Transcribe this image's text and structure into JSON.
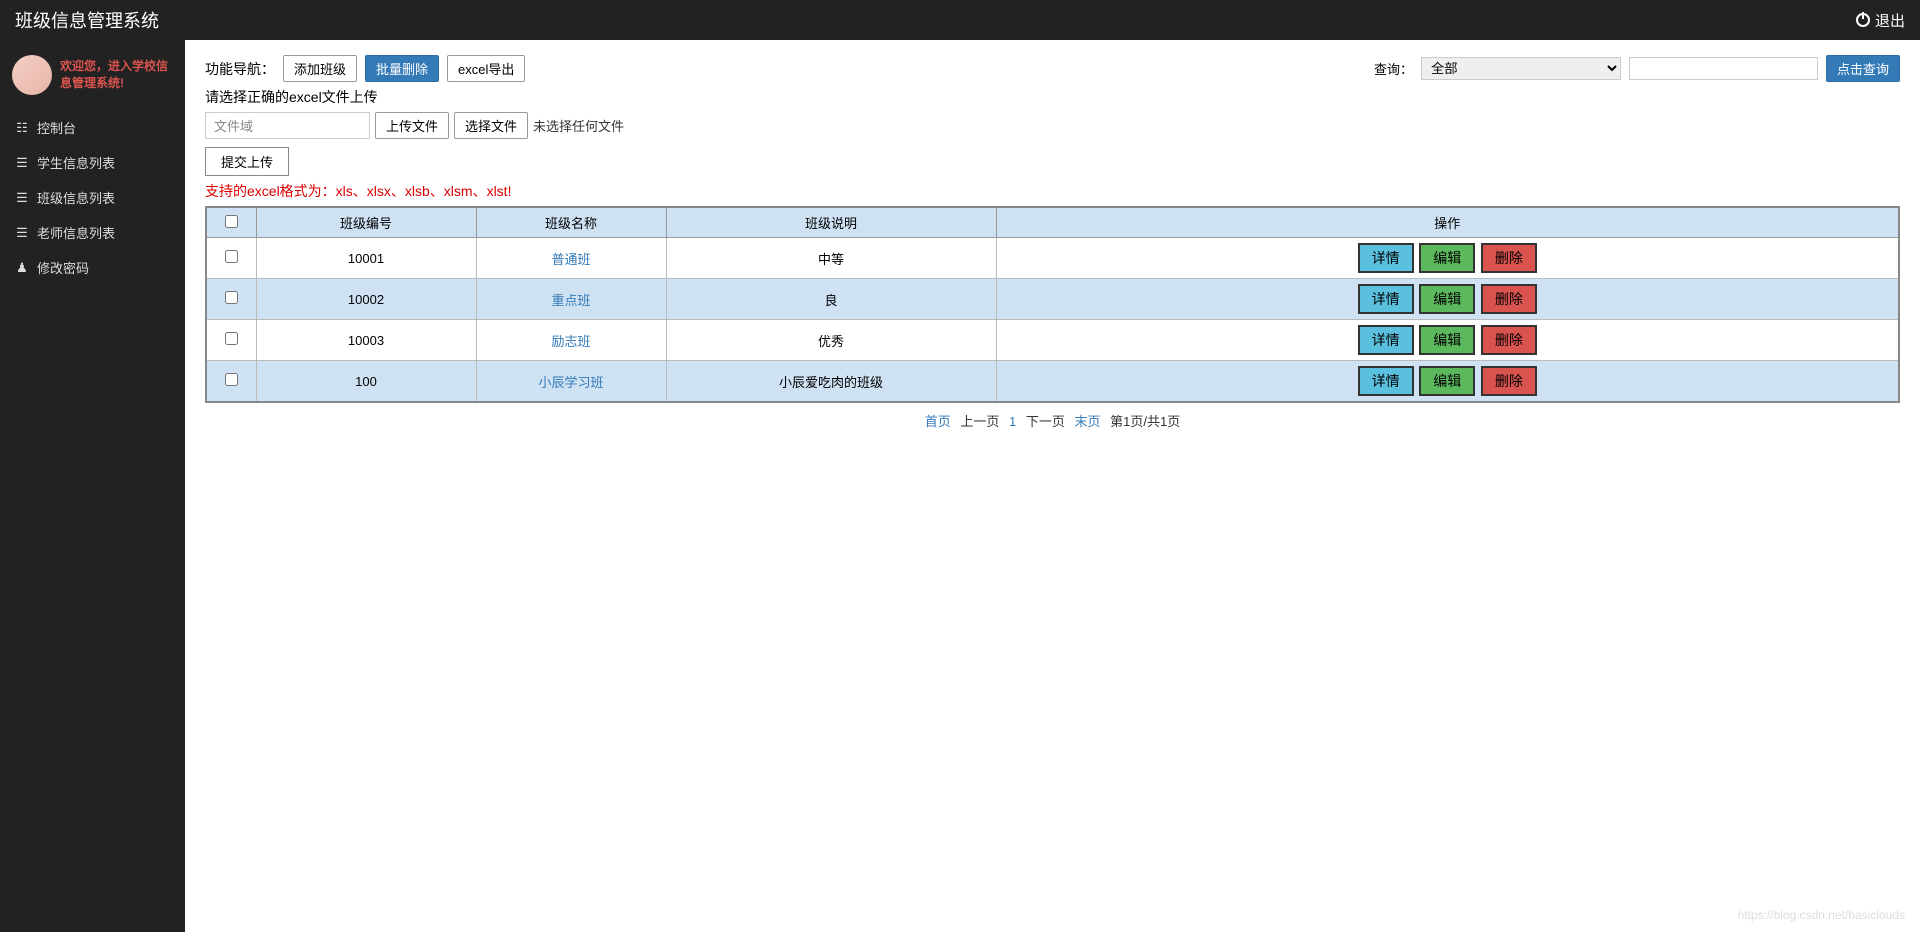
{
  "header": {
    "title": "班级信息管理系统",
    "logout": "退出"
  },
  "sidebar": {
    "welcome": "欢迎您，进入学校信息管理系统!",
    "items": [
      {
        "icon": "dashboard",
        "label": "控制台"
      },
      {
        "icon": "list",
        "label": "学生信息列表"
      },
      {
        "icon": "list",
        "label": "班级信息列表"
      },
      {
        "icon": "list",
        "label": "老师信息列表"
      },
      {
        "icon": "user",
        "label": "修改密码"
      }
    ]
  },
  "toolbar": {
    "nav_label": "功能导航：",
    "add_button": "添加班级",
    "batch_delete": "批量删除",
    "excel_export": "excel导出",
    "query_label": "查询：",
    "query_select": "全部",
    "query_button": "点击查询"
  },
  "upload": {
    "hint": "请选择正确的excel文件上传",
    "file_placeholder": "文件域",
    "upload_button": "上传文件",
    "choose_button": "选择文件",
    "no_file": "未选择任何文件",
    "submit_button": "提交上传",
    "format_hint": "支持的excel格式为：xls、xlsx、xlsb、xlsm、xlst!"
  },
  "table": {
    "headers": {
      "id": "班级编号",
      "name": "班级名称",
      "desc": "班级说明",
      "action": "操作"
    },
    "actions": {
      "detail": "详情",
      "edit": "编辑",
      "delete": "删除"
    },
    "rows": [
      {
        "id": "10001",
        "name": "普通班",
        "desc": "中等"
      },
      {
        "id": "10002",
        "name": "重点班",
        "desc": "良"
      },
      {
        "id": "10003",
        "name": "励志班",
        "desc": "优秀"
      },
      {
        "id": "100",
        "name": "小辰学习班",
        "desc": "小辰爱吃肉的班级"
      }
    ]
  },
  "pagination": {
    "first": "首页",
    "prev": "上一页",
    "page": "1",
    "next": "下一页",
    "last": "末页",
    "info": "第1页/共1页"
  },
  "watermark": "https://blog.csdn.net/basiclouds"
}
